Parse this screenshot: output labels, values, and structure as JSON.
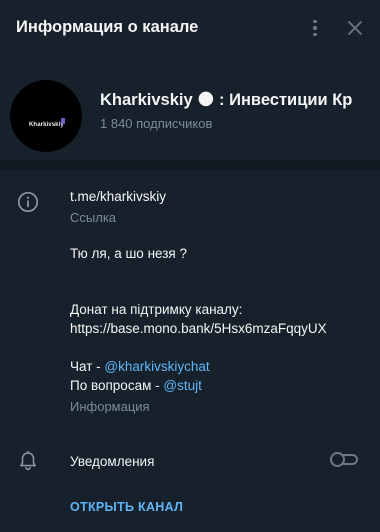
{
  "header": {
    "title": "Информация о канале",
    "menu_icon": "more-vertical-icon",
    "close_icon": "close-icon"
  },
  "profile": {
    "avatar_text": "Kharkivskiy",
    "channel_name": "Kharkivskiy 🌑 : Инвестиции Кр",
    "subscribers": "1 840 подписчиков"
  },
  "info": {
    "link": "t.me/kharkivskiy",
    "link_label": "Ссылка",
    "desc_line1": "Тю ля, а шо незя ?",
    "desc_line2": "Донат на підтримку каналу:",
    "donate_link": "https://base.mono.bank/5Hsx6mzaFqqyUX",
    "chat_prefix": "Чат - ",
    "chat_link": "@kharkivskiychat",
    "questions_prefix": "По вопросам - ",
    "questions_link": "@stujt",
    "info_label": "Информация"
  },
  "notifications": {
    "label": "Уведомления",
    "enabled": false
  },
  "open_channel_label": "ОТКРЫТЬ КАНАЛ",
  "colors": {
    "background": "#17212b",
    "accent": "#5eb5f7",
    "secondary_text": "#7d8b99",
    "divider": "#101921"
  }
}
